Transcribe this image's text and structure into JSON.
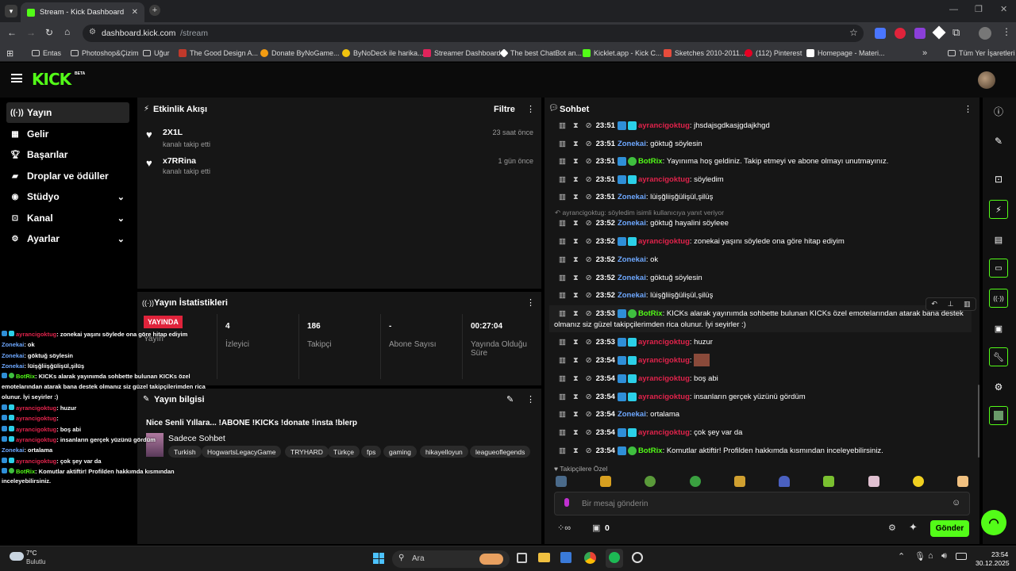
{
  "browser": {
    "tab_title": "Stream - Kick Dashboard",
    "url_host": "dashboard.kick.com",
    "url_path": "/stream",
    "bookmarks": [
      "Entas",
      "Photoshop&Çizim",
      "Uğur",
      "The Good Design A...",
      "Donate ByNoGame...",
      "ByNoDeck ile harika...",
      "Streamer Dashboard",
      "The best ChatBot an...",
      "Kicklet.app - Kick C...",
      "Sketches 2010-2011...",
      "(112) Pinterest",
      "Homepage - Materi..."
    ],
    "all_bookmarks": "Tüm Yer İşaretleri"
  },
  "app": {
    "logo": "KICK",
    "logo_beta": "BETA",
    "colors": {
      "accent": "#53fc18",
      "panel": "#161616",
      "red_user": "#e0234b",
      "blue_user": "#6ea8ff"
    }
  },
  "sidebar": {
    "items": [
      {
        "label": "Yayın",
        "icon": "broadcast-icon"
      },
      {
        "label": "Gelir",
        "icon": "revenue-icon"
      },
      {
        "label": "Başarılar",
        "icon": "trophy-icon"
      },
      {
        "label": "Droplar ve ödüller",
        "icon": "drops-icon"
      },
      {
        "label": "Stüdyo",
        "icon": "studio-icon"
      },
      {
        "label": "Kanal",
        "icon": "channel-icon"
      },
      {
        "label": "Ayarlar",
        "icon": "gear-icon"
      }
    ]
  },
  "activity": {
    "title": "Etkinlik Akışı",
    "filter": "Filtre",
    "events": [
      {
        "user": "2X1L",
        "text": "kanalı takip etti",
        "time": "23 saat önce"
      },
      {
        "user": "x7RRina",
        "text": "kanalı takip etti",
        "time": "1 gün önce"
      }
    ]
  },
  "stats": {
    "title": "Yayın İstatistikleri",
    "live_badge": "YAYINDA",
    "live_label": "Yayın",
    "items": [
      {
        "value": "4",
        "label": "İzleyici"
      },
      {
        "value": "186",
        "label": "Takipçi"
      },
      {
        "value": "-",
        "label": "Abone Sayısı"
      },
      {
        "value": "00:27:04",
        "label": "Yayında Olduğu Süre"
      }
    ]
  },
  "info": {
    "title": "Yayın bilgisi",
    "stream_title": "Nice Senli Yıllara... !ABONE !KICKs !donate !insta !blerp",
    "category": "Sadece Sohbet",
    "tags": [
      "Turkish",
      "HogwartsLegacyGame",
      "TRYHARD",
      "Türkçe",
      "fps",
      "gaming",
      "hikayelloyun",
      "leagueoflegends"
    ]
  },
  "chat": {
    "title": "Sohbet",
    "reply_note": "ayrancigoktug: söyledim isimli kullanıcıya yanıt veriyor",
    "messages": [
      {
        "time": "23:51",
        "user": "ayrancigoktug",
        "type": "red",
        "text": "jhsdajsgdkasjgdajkhgd"
      },
      {
        "time": "23:51",
        "user": "Zonekai",
        "type": "blue",
        "text": "göktuğ söylesin"
      },
      {
        "time": "23:51",
        "user": "BotRix",
        "type": "green",
        "text": "Yayınıma hoş geldiniz. Takip etmeyi ve abone olmayı unutmayınız."
      },
      {
        "time": "23:51",
        "user": "ayrancigoktug",
        "type": "red",
        "text": "söyledim"
      },
      {
        "time": "23:51",
        "user": "Zonekai",
        "type": "blue",
        "text": "lüişğliişğülişül,şilüş"
      },
      {
        "time": "23:52",
        "user": "Zonekai",
        "type": "blue",
        "text": "göktuğ hayalini söyleee"
      },
      {
        "time": "23:52",
        "user": "ayrancigoktug",
        "type": "red",
        "text": "zonekai yaşını söylede ona göre hitap ediyim"
      },
      {
        "time": "23:52",
        "user": "Zonekai",
        "type": "blue",
        "text": "ok"
      },
      {
        "time": "23:52",
        "user": "Zonekai",
        "type": "blue",
        "text": "göktuğ söylesin"
      },
      {
        "time": "23:52",
        "user": "Zonekai",
        "type": "blue",
        "text": "lüişğliişğülişül,şilüş"
      },
      {
        "time": "23:53",
        "user": "BotRix",
        "type": "green",
        "text": "KICKs alarak yayınımda sohbette bulunan KICKs özel emotelarından atarak bana destek",
        "text2": "olmanız siz güzel takipçilerimden rica olunur. İyi seyirler :)"
      },
      {
        "time": "23:53",
        "user": "ayrancigoktug",
        "type": "red",
        "text": "huzur"
      },
      {
        "time": "23:54",
        "user": "ayrancigoktug",
        "type": "red",
        "text": ""
      },
      {
        "time": "23:54",
        "user": "ayrancigoktug",
        "type": "red",
        "text": "boş abi"
      },
      {
        "time": "23:54",
        "user": "ayrancigoktug",
        "type": "red",
        "text": "insanların gerçek yüzünü gördüm"
      },
      {
        "time": "23:54",
        "user": "Zonekai",
        "type": "blue",
        "text": "ortalama"
      },
      {
        "time": "23:54",
        "user": "ayrancigoktug",
        "type": "red",
        "text": "çok şey var da"
      },
      {
        "time": "23:54",
        "user": "BotRix",
        "type": "green",
        "text": "Komutlar aktiftir! Profilden hakkımda kısmından inceleyebilirsiniz."
      }
    ],
    "followers_only": "Takipçilere Özel",
    "input_placeholder": "Bir mesaj gönderin",
    "points": "0",
    "send": "Gönder"
  },
  "overlay": {
    "lines": [
      {
        "user": "ayrancigoktug",
        "type": "red",
        "text": ": zonekai yaşını söylede ona göre hitap ediyim"
      },
      {
        "user": "Zonekai",
        "type": "blue",
        "text": ": ok"
      },
      {
        "user": "Zonekai",
        "type": "blue",
        "text": ": göktuğ söylesin"
      },
      {
        "user": "Zonekai",
        "type": "blue",
        "text": ": lüişğliişğülişül,şilüş"
      },
      {
        "user": "BotRix",
        "type": "green",
        "text": ": KICKs alarak yayınımda sohbette bulunan KICKs özel"
      },
      {
        "user": "",
        "type": "none",
        "text": "emotelarından atarak bana destek olmanız siz güzel takipçilerimden rica"
      },
      {
        "user": "",
        "type": "none",
        "text": "olunur. İyi seyirler :)"
      },
      {
        "user": "ayrancigoktug",
        "type": "red",
        "text": ": huzur"
      },
      {
        "user": "ayrancigoktug",
        "type": "red",
        "text": ":"
      },
      {
        "user": "ayrancigoktug",
        "type": "red",
        "text": ": boş abi"
      },
      {
        "user": "ayrancigoktug",
        "type": "red",
        "text": ": insanların gerçek yüzünü gördüm"
      },
      {
        "user": "Zonekai",
        "type": "blue",
        "text": ": ortalama"
      },
      {
        "user": "ayrancigoktug",
        "type": "red",
        "text": ": çok şey var da"
      },
      {
        "user": "BotRix",
        "type": "green",
        "text": ": Komutlar aktiftir! Profilden hakkımda kısmından"
      },
      {
        "user": "",
        "type": "none",
        "text": "inceleyebilirsiniz."
      }
    ]
  },
  "taskbar": {
    "temp": "7°C",
    "weather": "Bulutlu",
    "search": "Ara",
    "time": "23:54",
    "date": "30.12.2025"
  }
}
